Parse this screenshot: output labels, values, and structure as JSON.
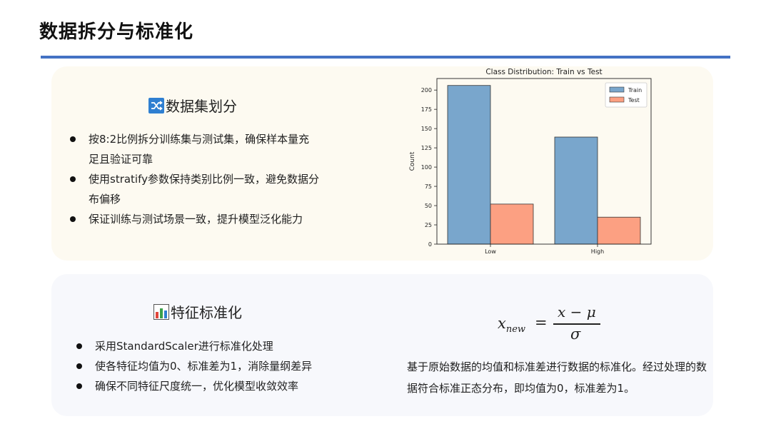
{
  "page": {
    "title": "数据拆分与标准化",
    "accent_color": "#4472c4"
  },
  "split_section": {
    "heading": "数据集划分",
    "icon": "shuffle-icon",
    "bullets": [
      "按8:2比例拆分训练集与测试集，确保样本量充足且验证可靠",
      "使用stratify参数保持类别比例一致，避免数据分布偏移",
      "保证训练与测试场景一致，提升模型泛化能力"
    ]
  },
  "norm_section": {
    "heading": "特征标准化",
    "icon": "bar-chart-icon",
    "bullets": [
      "采用StandardScaler进行标准化处理",
      "使各特征均值为0、标准差为1，消除量纲差异",
      "确保不同特征尺度统一，优化模型收敛效率"
    ],
    "formula": {
      "lhs": "x",
      "lhs_sub": "new",
      "eq": "=",
      "numerator": "x − μ",
      "denominator": "σ"
    },
    "description": "基于原始数据的均值和标准差进行数据的标准化。经过处理的数据符合标准正态分布，即均值为0，标准差为1。"
  },
  "chart_data": {
    "type": "bar",
    "title": "Class Distribution: Train vs Test",
    "xlabel": "",
    "ylabel": "Count",
    "categories": [
      "Low",
      "High"
    ],
    "series": [
      {
        "name": "Train",
        "values": [
          206,
          139
        ],
        "color": "#79a6cc"
      },
      {
        "name": "Test",
        "values": [
          52,
          35
        ],
        "color": "#fca082"
      }
    ],
    "ylim": [
      0,
      215
    ],
    "yticks": [
      "0",
      "25",
      "50",
      "75",
      "100",
      "125",
      "150",
      "175",
      "200"
    ],
    "legend": "top-right",
    "grid": false
  }
}
